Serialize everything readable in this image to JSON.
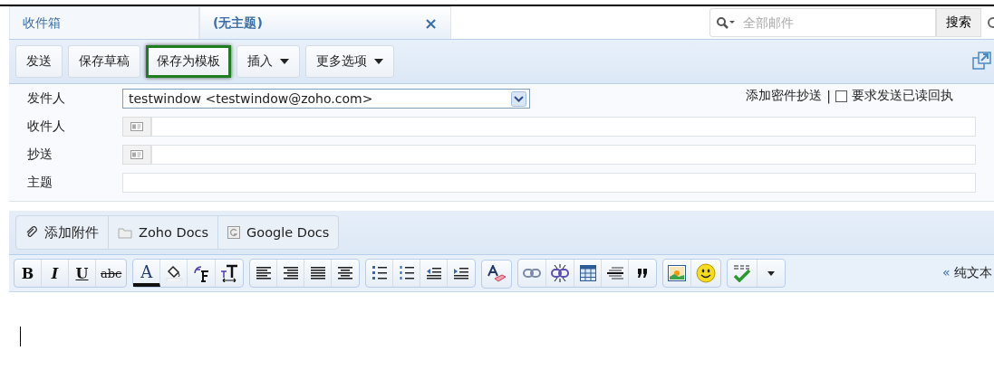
{
  "tabs": [
    {
      "label": "收件箱",
      "selected": false
    },
    {
      "label": "(无主题)",
      "selected": true,
      "close": "×"
    }
  ],
  "search": {
    "placeholder": "全部邮件",
    "button": "搜索"
  },
  "toolbar": [
    {
      "label": "发送",
      "selected": false,
      "dropdown": false
    },
    {
      "label": "保存草稿",
      "selected": false,
      "dropdown": false
    },
    {
      "label": "保存为模板",
      "selected": true,
      "dropdown": false
    },
    {
      "label": "插入",
      "selected": false,
      "dropdown": true
    },
    {
      "label": "更多选项",
      "selected": false,
      "dropdown": true
    }
  ],
  "form": {
    "from_label": "发件人",
    "from_value": "testwindow <testwindow@zoho.com>",
    "bcc_link": "添加密件抄送",
    "separator": "|",
    "read_receipt": {
      "label": "要求发送已读回执",
      "checked": false
    },
    "rows": [
      {
        "label": "收件人",
        "kind": "contact"
      },
      {
        "label": "抄送",
        "kind": "contact"
      },
      {
        "label": "主题",
        "kind": "plain"
      }
    ]
  },
  "attach": [
    "添加附件",
    "Zoho Docs",
    "Google Docs"
  ],
  "format_glyphs": [
    "B",
    "I",
    "U",
    "abc",
    "A"
  ],
  "plain_text": {
    "arrow": "«",
    "label": "纯文本"
  }
}
